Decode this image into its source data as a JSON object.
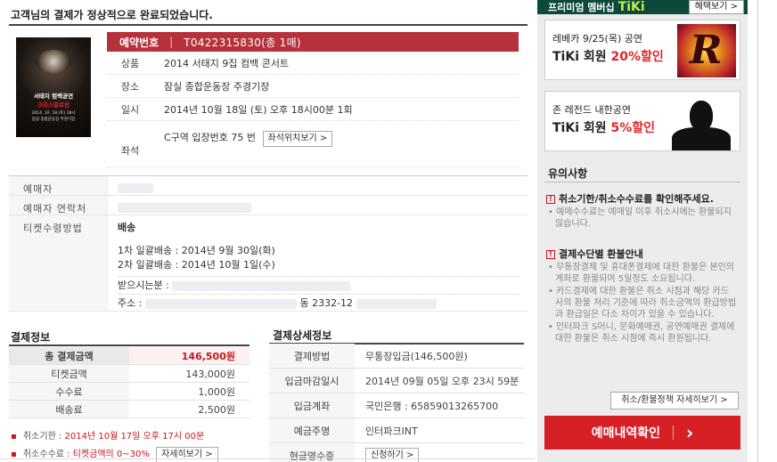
{
  "header": {
    "complete_message": "고객님의 결제가 정상적으로 완료되었습니다."
  },
  "poster": {
    "line1": "서태지 컴백공연",
    "line2": "크리스말로윈",
    "line3": "2014. 10. 18.(토) 18시",
    "line4": "잠실 종합운동장 주경기장"
  },
  "reservation": {
    "label": "예약번호",
    "number": "T0422315830(총 1매)"
  },
  "performance": {
    "rows": [
      {
        "key": "상품",
        "value": "2014 서태지 9집 컴백 콘서트"
      },
      {
        "key": "장소",
        "value": "잠실 종합운동장 주경기장"
      },
      {
        "key": "일시",
        "value": "2014년 10월 18일 (토) 오후 18시00분 1회"
      }
    ],
    "seat_key": "좌석",
    "seat_value": "C구역 입장번호 75 번",
    "seat_button": "좌석위치보기 >"
  },
  "booker": {
    "name_key": "예매자",
    "contact_key": "예매자 연락처",
    "method_key": "티켓수령방법",
    "method_value": "배송",
    "ship1": "1차 일괄배송 : 2014년 9월 30일(화)",
    "ship2": "2차 일괄배송 : 2014년 10월 1일(수)",
    "receiver_label": "받으시는분 :",
    "address_label": "주소 :",
    "address_visible": "동 2332-12"
  },
  "payment": {
    "title": "결제정보",
    "rows": [
      {
        "key": "총 결제금액",
        "value": "146,500원"
      },
      {
        "key": "티켓금액",
        "value": "143,000원"
      },
      {
        "key": "수수료",
        "value": "1,000원"
      },
      {
        "key": "배송료",
        "value": "2,500원"
      }
    ]
  },
  "notes": {
    "cancel_deadline_label": "취소기한 :",
    "cancel_deadline_value": "2014년 10월 17일 오후 17시 00분",
    "cancel_fee_label": "취소수수료 :",
    "cancel_fee_value": "티켓금액의 0~30%",
    "detail_button": "자세히보기 >"
  },
  "payment_detail": {
    "title": "결제상세정보",
    "rows": [
      {
        "key": "결제방법",
        "value": "무통장입금(146,500원)"
      },
      {
        "key": "입금마감일시",
        "value": "2014년 09월 05일 오후 23시 59분"
      },
      {
        "key": "입금계좌",
        "value": "국민은행 : 65859013265700"
      },
      {
        "key": "예금주명",
        "value": "인터파크INT"
      },
      {
        "key": "현금영수증",
        "value": ""
      }
    ],
    "receipt_button": "신청하기 >"
  },
  "sidebar": {
    "premium_label": "프리미엄 멤버십",
    "premium_brand": "TiKi",
    "benefit_button": "혜택보기 >",
    "promo1_line1": "레베카 9/25(목) 공연",
    "promo1_line2_prefix": "TiKi 회원 ",
    "promo1_line2_pct": "20%할인",
    "promo2_line1": "존 레전드 내한공연",
    "promo2_line2_prefix": "TiKi 회원 ",
    "promo2_line2_pct": "5%할인",
    "caution_title": "유의사항",
    "c1_head": "취소기한/취소수수료를 확인해주세요.",
    "c1_body": "• 예매수수료는 예매일 이후 취소시에는 환불되지 않습니다.",
    "c2_head": "결제수단별 환불안내",
    "c2_items": [
      "• 무통장결제 및 휴대폰결제에 대한 환불은 본인의 계좌로 환불되며 5일정도 소요됩니다.",
      "• 카드결제에 대한 환불은 취소 시점과 해당 카드사의 환불 처리 기준에 따라 취소금액의 환급방법과 환급일은 다소 차이가 있을 수 있습니다.",
      "• 인터파크 S머니, 문화예매권, 공연예매권 결제에 대한 환불은 취소 시점에 즉시 환원됩니다."
    ],
    "policy_button": "취소/환불정책 자세히보기 >",
    "confirm_button": "예매내역확인",
    "confirm_arrow": "›"
  },
  "colors": {
    "accent_red": "#d71f26",
    "reservation_bar": "#b6313c",
    "sidebar_header": "#0b4a3a"
  }
}
